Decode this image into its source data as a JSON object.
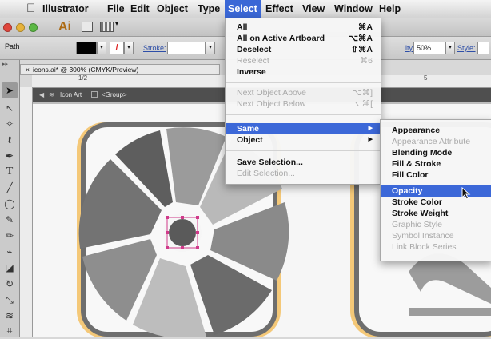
{
  "menubar": {
    "app_name": "Illustrator",
    "items": [
      "File",
      "Edit",
      "Object",
      "Type",
      "Select",
      "Effect",
      "View",
      "Window",
      "Help"
    ],
    "selected": "Select"
  },
  "appbar": {
    "logo": "Ai"
  },
  "controlbar": {
    "object_type": "Path",
    "stroke_label": "Stroke:",
    "opacity_label": "ity:",
    "opacity_value": "50%",
    "style_label": "Style:"
  },
  "document": {
    "tab_title": "icons.ai* @ 300% (CMYK/Preview)",
    "ruler_marks": [
      "1/2",
      "5"
    ],
    "isolation_path": [
      "Icon Art",
      "<Group>"
    ]
  },
  "select_menu": [
    {
      "label": "All",
      "shortcut": "⌘A",
      "enabled": true
    },
    {
      "label": "All on Active Artboard",
      "shortcut": "⌥⌘A",
      "enabled": true
    },
    {
      "label": "Deselect",
      "shortcut": "⇧⌘A",
      "enabled": true
    },
    {
      "label": "Reselect",
      "shortcut": "⌘6",
      "enabled": false
    },
    {
      "label": "Inverse",
      "shortcut": "",
      "enabled": true
    },
    {
      "label": "Next Object Above",
      "shortcut": "⌥⌘]",
      "enabled": false
    },
    {
      "label": "Next Object Below",
      "shortcut": "⌥⌘[",
      "enabled": false
    },
    {
      "label": "Same",
      "shortcut": "",
      "enabled": true,
      "submenu": true,
      "highlighted": true
    },
    {
      "label": "Object",
      "shortcut": "",
      "enabled": true,
      "submenu": true
    },
    {
      "label": "Save Selection...",
      "shortcut": "",
      "enabled": true
    },
    {
      "label": "Edit Selection...",
      "shortcut": "",
      "enabled": false
    }
  ],
  "same_submenu": [
    {
      "label": "Appearance",
      "enabled": true
    },
    {
      "label": "Appearance Attribute",
      "enabled": false
    },
    {
      "label": "Blending Mode",
      "enabled": true
    },
    {
      "label": "Fill & Stroke",
      "enabled": true
    },
    {
      "label": "Fill Color",
      "enabled": true
    },
    {
      "label": "Opacity",
      "enabled": true,
      "highlighted": true
    },
    {
      "label": "Stroke Color",
      "enabled": true
    },
    {
      "label": "Stroke Weight",
      "enabled": true
    },
    {
      "label": "Graphic Style",
      "enabled": false
    },
    {
      "label": "Symbol Instance",
      "enabled": false
    },
    {
      "label": "Link Block Series",
      "enabled": false
    }
  ],
  "colors": {
    "menu_highlight": "#3c68d8",
    "artboard_border": "#f4c878",
    "icon_frame": "#6e6e6e",
    "selection": "#d03a8a"
  }
}
